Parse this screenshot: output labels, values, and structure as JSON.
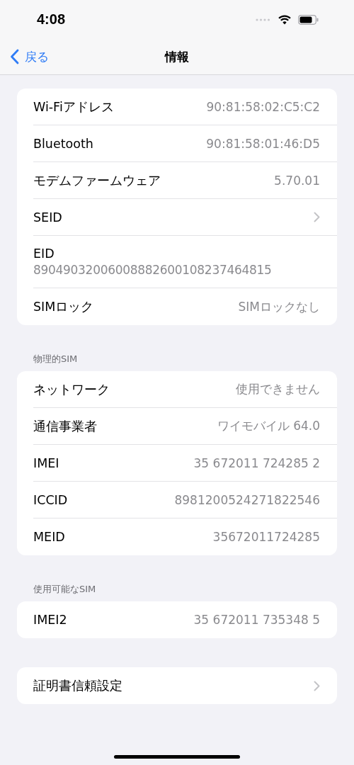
{
  "status_bar": {
    "time": "4:08"
  },
  "nav_bar": {
    "back": "戻る",
    "title": "情報"
  },
  "sections": [
    {
      "rows": [
        {
          "kind": "value",
          "label": "Wi-Fiアドレス",
          "value": "90:81:58:02:C5:C2"
        },
        {
          "kind": "value",
          "label": "Bluetooth",
          "value": "90:81:58:01:46:D5"
        },
        {
          "kind": "value",
          "label": "モデムファームウェア",
          "value": "5.70.01"
        },
        {
          "kind": "chevron",
          "label": "SEID"
        },
        {
          "kind": "stacked",
          "label": "EID",
          "value": "89049032006008882600108237464815"
        },
        {
          "kind": "value",
          "label": "SIMロック",
          "value": "SIMロックなし"
        }
      ]
    },
    {
      "header": "物理的SIM",
      "rows": [
        {
          "kind": "value",
          "label": "ネットワーク",
          "value": "使用できません"
        },
        {
          "kind": "value",
          "label": "通信事業者",
          "value": "ワイモバイル 64.0"
        },
        {
          "kind": "value",
          "label": "IMEI",
          "value": "35 672011 724285 2"
        },
        {
          "kind": "value",
          "label": "ICCID",
          "value": "8981200524271822546"
        },
        {
          "kind": "value",
          "label": "MEID",
          "value": "35672011724285"
        }
      ]
    },
    {
      "header": "使用可能なSIM",
      "rows": [
        {
          "kind": "value",
          "label": "IMEI2",
          "value": "35 672011 735348 5"
        }
      ]
    },
    {
      "rows": [
        {
          "kind": "chevron",
          "label": "証明書信頼設定"
        }
      ]
    }
  ]
}
